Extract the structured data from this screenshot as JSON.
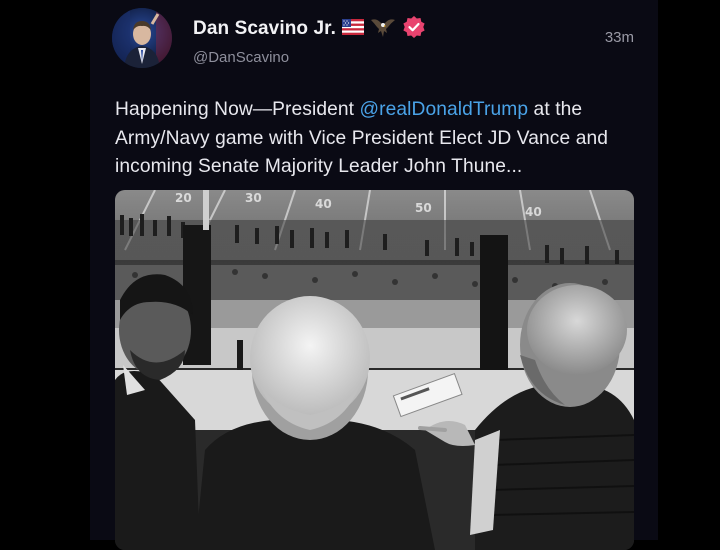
{
  "post": {
    "author": {
      "display_name": "Dan Scavino Jr.",
      "handle": "@DanScavino",
      "avatar_icon": "profile-photo",
      "badges": [
        "us-flag-icon",
        "eagle-icon",
        "verified-badge-icon"
      ],
      "verified_color": "#e8436f"
    },
    "timestamp": "33m",
    "text_before_mention": "Happening Now—President ",
    "mention": "@realDonaldTrump",
    "text_after_mention": " at the Army/Navy game with Vice President Elect JD Vance and incoming Senate Majority Leader John Thune...",
    "media": {
      "type": "photo",
      "style": "black-and-white",
      "field_numbers": [
        "20",
        "30",
        "40",
        "50",
        "40"
      ]
    }
  },
  "colors": {
    "background": "#000000",
    "card": "#0a0a14",
    "link": "#4aa3e8",
    "text": "#e8e8ee",
    "muted": "#8e8f9c"
  }
}
